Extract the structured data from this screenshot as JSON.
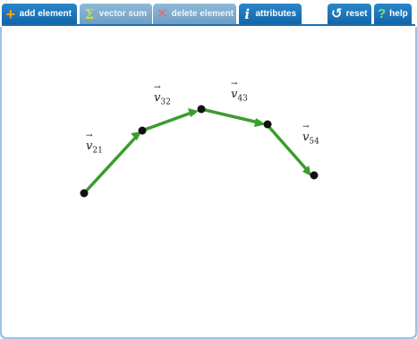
{
  "toolbar": {
    "add_element": {
      "label": "add element",
      "icon": "plus-icon"
    },
    "vector_sum": {
      "label": "vector sum",
      "icon": "sigma-icon"
    },
    "delete_element": {
      "label": "delete element",
      "icon": "x-icon"
    },
    "attributes": {
      "label": "attributes",
      "icon": "info-icon"
    },
    "reset": {
      "label": "reset",
      "icon": "reset-icon"
    },
    "help": {
      "label": "help",
      "icon": "help-icon"
    }
  },
  "vectors": [
    {
      "name": "v",
      "sub": "21"
    },
    {
      "name": "v",
      "sub": "32"
    },
    {
      "name": "v",
      "sub": "43"
    },
    {
      "name": "v",
      "sub": "54"
    }
  ],
  "colors": {
    "vector": "#3a9d2d",
    "point": "#111111",
    "tab_active": "#1b74b8",
    "frame": "#9dc3e6"
  }
}
